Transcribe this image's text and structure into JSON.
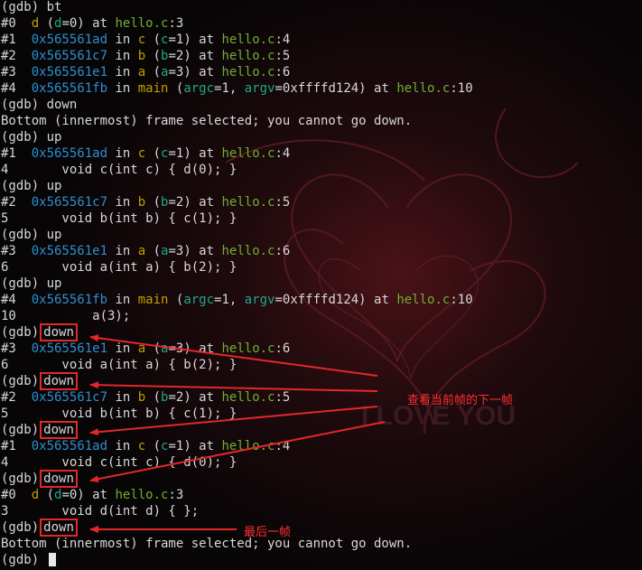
{
  "background": {
    "watermark": "I LOVE YOU"
  },
  "lines": [
    [
      {
        "t": "(gdb) bt"
      }
    ],
    [
      {
        "t": "#0  "
      },
      {
        "t": "d",
        "c": "fn"
      },
      {
        "t": " ("
      },
      {
        "t": "d",
        "c": "var"
      },
      {
        "t": "=0) at "
      },
      {
        "t": "hello.c",
        "c": "file"
      },
      {
        "t": ":3"
      }
    ],
    [
      {
        "t": "#1  "
      },
      {
        "t": "0x565561ad",
        "c": "addr"
      },
      {
        "t": " in "
      },
      {
        "t": "c",
        "c": "fn"
      },
      {
        "t": " ("
      },
      {
        "t": "c",
        "c": "var"
      },
      {
        "t": "=1) at "
      },
      {
        "t": "hello.c",
        "c": "file"
      },
      {
        "t": ":4"
      }
    ],
    [
      {
        "t": "#2  "
      },
      {
        "t": "0x565561c7",
        "c": "addr"
      },
      {
        "t": " in "
      },
      {
        "t": "b",
        "c": "fn"
      },
      {
        "t": " ("
      },
      {
        "t": "b",
        "c": "var"
      },
      {
        "t": "=2) at "
      },
      {
        "t": "hello.c",
        "c": "file"
      },
      {
        "t": ":5"
      }
    ],
    [
      {
        "t": "#3  "
      },
      {
        "t": "0x565561e1",
        "c": "addr"
      },
      {
        "t": " in "
      },
      {
        "t": "a",
        "c": "fn"
      },
      {
        "t": " ("
      },
      {
        "t": "a",
        "c": "var"
      },
      {
        "t": "=3) at "
      },
      {
        "t": "hello.c",
        "c": "file"
      },
      {
        "t": ":6"
      }
    ],
    [
      {
        "t": "#4  "
      },
      {
        "t": "0x565561fb",
        "c": "addr"
      },
      {
        "t": " in "
      },
      {
        "t": "main",
        "c": "fn"
      },
      {
        "t": " ("
      },
      {
        "t": "argc",
        "c": "var"
      },
      {
        "t": "=1, "
      },
      {
        "t": "argv",
        "c": "var"
      },
      {
        "t": "=0xffffd124) at "
      },
      {
        "t": "hello.c",
        "c": "file"
      },
      {
        "t": ":10"
      }
    ],
    [
      {
        "t": "(gdb) down"
      }
    ],
    [
      {
        "t": "Bottom (innermost) frame selected; you cannot go down."
      }
    ],
    [
      {
        "t": "(gdb) up"
      }
    ],
    [
      {
        "t": "#1  "
      },
      {
        "t": "0x565561ad",
        "c": "addr"
      },
      {
        "t": " in "
      },
      {
        "t": "c",
        "c": "fn"
      },
      {
        "t": " ("
      },
      {
        "t": "c",
        "c": "var"
      },
      {
        "t": "=1) at "
      },
      {
        "t": "hello.c",
        "c": "file"
      },
      {
        "t": ":4"
      }
    ],
    [
      {
        "t": "4       void c(int c) { d(0); }"
      }
    ],
    [
      {
        "t": "(gdb) up"
      }
    ],
    [
      {
        "t": "#2  "
      },
      {
        "t": "0x565561c7",
        "c": "addr"
      },
      {
        "t": " in "
      },
      {
        "t": "b",
        "c": "fn"
      },
      {
        "t": " ("
      },
      {
        "t": "b",
        "c": "var"
      },
      {
        "t": "=2) at "
      },
      {
        "t": "hello.c",
        "c": "file"
      },
      {
        "t": ":5"
      }
    ],
    [
      {
        "t": "5       void b(int b) { c(1); }"
      }
    ],
    [
      {
        "t": "(gdb) up"
      }
    ],
    [
      {
        "t": "#3  "
      },
      {
        "t": "0x565561e1",
        "c": "addr"
      },
      {
        "t": " in "
      },
      {
        "t": "a",
        "c": "fn"
      },
      {
        "t": " ("
      },
      {
        "t": "a",
        "c": "var"
      },
      {
        "t": "=3) at "
      },
      {
        "t": "hello.c",
        "c": "file"
      },
      {
        "t": ":6"
      }
    ],
    [
      {
        "t": "6       void a(int a) { b(2); }"
      }
    ],
    [
      {
        "t": "(gdb) up"
      }
    ],
    [
      {
        "t": "#4  "
      },
      {
        "t": "0x565561fb",
        "c": "addr"
      },
      {
        "t": " in "
      },
      {
        "t": "main",
        "c": "fn"
      },
      {
        "t": " ("
      },
      {
        "t": "argc",
        "c": "var"
      },
      {
        "t": "=1, "
      },
      {
        "t": "argv",
        "c": "var"
      },
      {
        "t": "=0xffffd124) at "
      },
      {
        "t": "hello.c",
        "c": "file"
      },
      {
        "t": ":10"
      }
    ],
    [
      {
        "t": "10          a(3);"
      }
    ],
    [
      {
        "t": "(gdb)"
      },
      {
        "t": "down",
        "box": true
      }
    ],
    [
      {
        "t": "#3  "
      },
      {
        "t": "0x565561e1",
        "c": "addr"
      },
      {
        "t": " in "
      },
      {
        "t": "a",
        "c": "fn"
      },
      {
        "t": " ("
      },
      {
        "t": "a",
        "c": "var"
      },
      {
        "t": "=3) at "
      },
      {
        "t": "hello.c",
        "c": "file"
      },
      {
        "t": ":6"
      }
    ],
    [
      {
        "t": "6       void a(int a) { b(2); }"
      }
    ],
    [
      {
        "t": "(gdb)"
      },
      {
        "t": "down",
        "box": true
      }
    ],
    [
      {
        "t": "#2  "
      },
      {
        "t": "0x565561c7",
        "c": "addr"
      },
      {
        "t": " in "
      },
      {
        "t": "b",
        "c": "fn"
      },
      {
        "t": " ("
      },
      {
        "t": "b",
        "c": "var"
      },
      {
        "t": "=2) at "
      },
      {
        "t": "hello.c",
        "c": "file"
      },
      {
        "t": ":5"
      }
    ],
    [
      {
        "t": "5       void b(int b) { c(1); }"
      }
    ],
    [
      {
        "t": "(gdb)"
      },
      {
        "t": "down",
        "box": true
      }
    ],
    [
      {
        "t": "#1  "
      },
      {
        "t": "0x565561ad",
        "c": "addr"
      },
      {
        "t": " in "
      },
      {
        "t": "c",
        "c": "fn"
      },
      {
        "t": " ("
      },
      {
        "t": "c",
        "c": "var"
      },
      {
        "t": "=1) at "
      },
      {
        "t": "hello.c",
        "c": "file"
      },
      {
        "t": ":4"
      }
    ],
    [
      {
        "t": "4       void c(int c) { d(0); }"
      }
    ],
    [
      {
        "t": "(gdb)"
      },
      {
        "t": "down",
        "box": true
      }
    ],
    [
      {
        "t": "#0  "
      },
      {
        "t": "d",
        "c": "fn"
      },
      {
        "t": " ("
      },
      {
        "t": "d",
        "c": "var"
      },
      {
        "t": "=0) at "
      },
      {
        "t": "hello.c",
        "c": "file"
      },
      {
        "t": ":3"
      }
    ],
    [
      {
        "t": "3       void d(int d) { };"
      }
    ],
    [
      {
        "t": "(gdb)"
      },
      {
        "t": "down",
        "box": true
      }
    ],
    [
      {
        "t": "Bottom (innermost) frame selected; you cannot go down."
      }
    ],
    [
      {
        "t": "(gdb) "
      }
    ]
  ],
  "annotations": {
    "view_next_frame": "查看当前帧的下一帧",
    "last_frame": "最后一帧"
  },
  "colors": {
    "address": "#2e8fd1",
    "function": "#c4a000",
    "variable": "#1fa88a",
    "file": "#70b030",
    "annotation": "#e3282a"
  }
}
